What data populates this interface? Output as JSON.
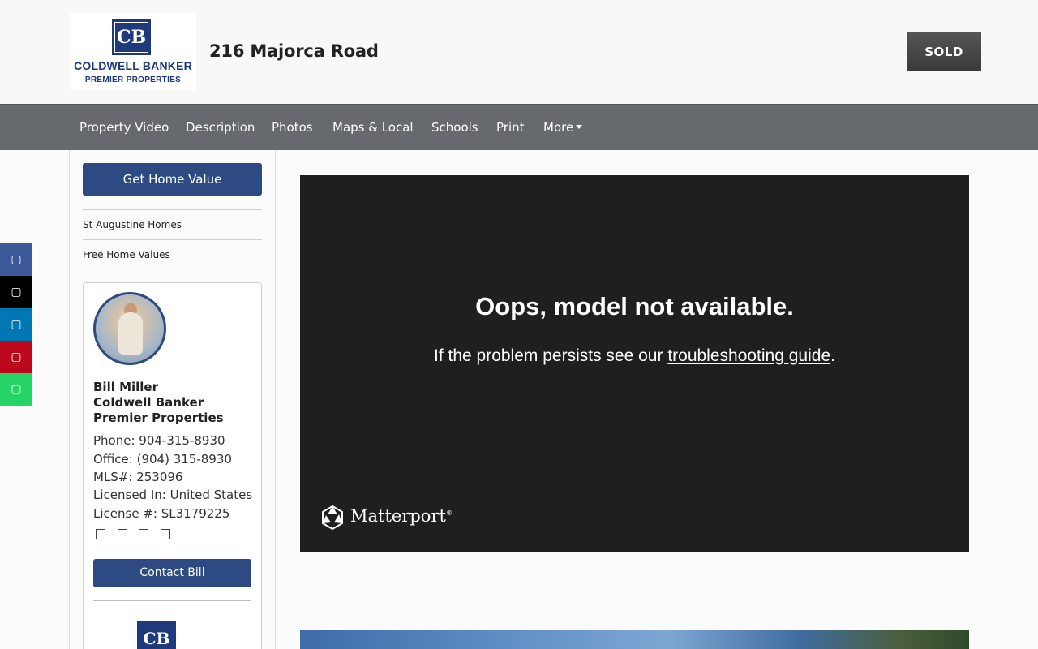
{
  "header": {
    "logo_line1": "COLDWELL BANKER",
    "logo_line2": "PREMIER PROPERTIES",
    "logo_mark": "CB",
    "address": "216 Majorca Road",
    "badge": "SOLD"
  },
  "nav": {
    "items": [
      "Property Video",
      "Description",
      "Photos",
      "Maps & Local",
      "Schools",
      "Print",
      "More"
    ]
  },
  "social": {
    "icons": [
      "facebook-icon",
      "x-twitter-icon",
      "linkedin-icon",
      "pinterest-icon",
      "whatsapp-icon"
    ],
    "colors": [
      "#3b5998",
      "#000000",
      "#0077b5",
      "#bd081c",
      "#25d366"
    ]
  },
  "sidebar": {
    "home_value_button": "Get Home Value",
    "links": [
      "St Augustine Homes",
      "Free Home Values"
    ]
  },
  "agent": {
    "name": "Bill Miller",
    "company": "Coldwell Banker Premier Properties",
    "phone": "Phone: 904-315-8930",
    "office": "Office: (904) 315-8930",
    "mls": "MLS#: 253096",
    "licensed_in": "Licensed In: United States",
    "license": "License #: SL3179225",
    "contact_button": "Contact Bill"
  },
  "video": {
    "title": "Oops, model not available.",
    "message_prefix": "If the problem persists see our ",
    "link_text": "troubleshooting guide",
    "message_suffix": ".",
    "brand": "Matterport",
    "brand_mark": "®"
  },
  "colors": {
    "brand_blue": "#2d4b82",
    "nav_bg": "#66696d",
    "video_bg": "#1f1f1f"
  }
}
